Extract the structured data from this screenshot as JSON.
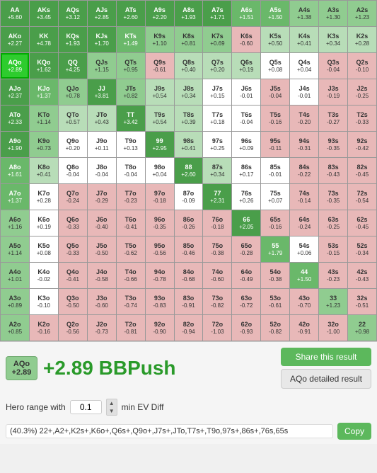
{
  "grid": {
    "cells": [
      {
        "name": "AA",
        "ev": "+5.60",
        "color": "green-dark"
      },
      {
        "name": "AKs",
        "ev": "+3.45",
        "color": "green-dark"
      },
      {
        "name": "AQs",
        "ev": "+3.12",
        "color": "green-dark"
      },
      {
        "name": "AJs",
        "ev": "+2.85",
        "color": "green-dark"
      },
      {
        "name": "ATs",
        "ev": "+2.60",
        "color": "green-dark"
      },
      {
        "name": "A9s",
        "ev": "+2.20",
        "color": "green-dark"
      },
      {
        "name": "A8s",
        "ev": "+1.93",
        "color": "green-dark"
      },
      {
        "name": "A7s",
        "ev": "+1.71",
        "color": "green-dark"
      },
      {
        "name": "A6s",
        "ev": "+1.51",
        "color": "green-mid"
      },
      {
        "name": "A5s",
        "ev": "+1.50",
        "color": "green-mid"
      },
      {
        "name": "A4s",
        "ev": "+1.38",
        "color": "green-light"
      },
      {
        "name": "A3s",
        "ev": "+1.30",
        "color": "green-light"
      },
      {
        "name": "A2s",
        "ev": "+1.23",
        "color": "green-light"
      },
      {
        "name": "AKo",
        "ev": "+2.27",
        "color": "green-dark"
      },
      {
        "name": "KK",
        "ev": "+4.78",
        "color": "green-dark"
      },
      {
        "name": "KQs",
        "ev": "+1.93",
        "color": "green-dark"
      },
      {
        "name": "KJs",
        "ev": "+1.70",
        "color": "green-dark"
      },
      {
        "name": "KTs",
        "ev": "+1.49",
        "color": "green-mid"
      },
      {
        "name": "K9s",
        "ev": "+1.10",
        "color": "green-light"
      },
      {
        "name": "K8s",
        "ev": "+0.81",
        "color": "green-light"
      },
      {
        "name": "K7s",
        "ev": "+0.69",
        "color": "green-light"
      },
      {
        "name": "K6s",
        "ev": "-0.60",
        "color": "red-pale"
      },
      {
        "name": "K5s",
        "ev": "+0.50",
        "color": "green-pale"
      },
      {
        "name": "K4s",
        "ev": "+0.41",
        "color": "green-pale"
      },
      {
        "name": "K3s",
        "ev": "+0.34",
        "color": "green-pale"
      },
      {
        "name": "K2s",
        "ev": "+0.28",
        "color": "green-pale"
      },
      {
        "name": "AQo",
        "ev": "+2.89",
        "color": "highlight"
      },
      {
        "name": "KQo",
        "ev": "+1.62",
        "color": "green-dark"
      },
      {
        "name": "QQ",
        "ev": "+4.25",
        "color": "green-dark"
      },
      {
        "name": "QJs",
        "ev": "+1.15",
        "color": "green-light"
      },
      {
        "name": "QTs",
        "ev": "+0.95",
        "color": "green-light"
      },
      {
        "name": "Q9s",
        "ev": "-0.61",
        "color": "red-pale"
      },
      {
        "name": "Q8s",
        "ev": "+0.40",
        "color": "green-pale"
      },
      {
        "name": "Q7s",
        "ev": "+0.20",
        "color": "green-pale"
      },
      {
        "name": "Q6s",
        "ev": "+0.19",
        "color": "green-pale"
      },
      {
        "name": "Q5s",
        "ev": "+0.08",
        "color": "white"
      },
      {
        "name": "Q4s",
        "ev": "+0.04",
        "color": "white"
      },
      {
        "name": "Q3s",
        "ev": "-0.04",
        "color": "red-pale"
      },
      {
        "name": "Q2s",
        "ev": "-0.10",
        "color": "red-pale"
      },
      {
        "name": "AJo",
        "ev": "+2.37",
        "color": "green-dark"
      },
      {
        "name": "KJo",
        "ev": "+1.37",
        "color": "green-mid"
      },
      {
        "name": "QJo",
        "ev": "+0.78",
        "color": "green-light"
      },
      {
        "name": "JJ",
        "ev": "+3.81",
        "color": "green-dark"
      },
      {
        "name": "JTs",
        "ev": "+0.82",
        "color": "green-light"
      },
      {
        "name": "J9s",
        "ev": "+0.54",
        "color": "green-pale"
      },
      {
        "name": "J8s",
        "ev": "+0.34",
        "color": "green-pale"
      },
      {
        "name": "J7s",
        "ev": "+0.15",
        "color": "white"
      },
      {
        "name": "J6s",
        "ev": "-0.01",
        "color": "white"
      },
      {
        "name": "J5s",
        "ev": "-0.04",
        "color": "red-pale"
      },
      {
        "name": "J4s",
        "ev": "-0.01",
        "color": "white"
      },
      {
        "name": "J3s",
        "ev": "-0.19",
        "color": "red-pale"
      },
      {
        "name": "J2s",
        "ev": "-0.25",
        "color": "red-pale"
      },
      {
        "name": "ATo",
        "ev": "+2.33",
        "color": "green-dark"
      },
      {
        "name": "KTo",
        "ev": "+1.14",
        "color": "green-light"
      },
      {
        "name": "QTo",
        "ev": "+0.57",
        "color": "green-pale"
      },
      {
        "name": "JTo",
        "ev": "+0.43",
        "color": "green-pale"
      },
      {
        "name": "TT",
        "ev": "+3.42",
        "color": "green-dark"
      },
      {
        "name": "T9s",
        "ev": "+0.54",
        "color": "green-pale"
      },
      {
        "name": "T8s",
        "ev": "+0.39",
        "color": "green-pale"
      },
      {
        "name": "T7s",
        "ev": "+0.18",
        "color": "white"
      },
      {
        "name": "T6s",
        "ev": "-0.04",
        "color": "white"
      },
      {
        "name": "T5s",
        "ev": "-0.16",
        "color": "red-pale"
      },
      {
        "name": "T4s",
        "ev": "-0.20",
        "color": "red-pale"
      },
      {
        "name": "T3s",
        "ev": "-0.27",
        "color": "red-pale"
      },
      {
        "name": "T2s",
        "ev": "-0.33",
        "color": "red-pale"
      },
      {
        "name": "A9o",
        "ev": "+1.90",
        "color": "green-dark"
      },
      {
        "name": "K9o",
        "ev": "+0.73",
        "color": "green-light"
      },
      {
        "name": "Q9o",
        "ev": "+0.20",
        "color": "white"
      },
      {
        "name": "J9o",
        "ev": "+0.11",
        "color": "white"
      },
      {
        "name": "T9o",
        "ev": "+0.13",
        "color": "white"
      },
      {
        "name": "99",
        "ev": "+2.95",
        "color": "green-dark"
      },
      {
        "name": "98s",
        "ev": "+0.41",
        "color": "green-pale"
      },
      {
        "name": "97s",
        "ev": "+0.25",
        "color": "white"
      },
      {
        "name": "96s",
        "ev": "+0.09",
        "color": "white"
      },
      {
        "name": "95s",
        "ev": "-0.11",
        "color": "red-pale"
      },
      {
        "name": "94s",
        "ev": "-0.31",
        "color": "red-pale"
      },
      {
        "name": "93s",
        "ev": "-0.35",
        "color": "red-pale"
      },
      {
        "name": "92s",
        "ev": "-0.42",
        "color": "red-pale"
      },
      {
        "name": "A8o",
        "ev": "+1.61",
        "color": "green-mid"
      },
      {
        "name": "K8o",
        "ev": "+0.41",
        "color": "green-pale"
      },
      {
        "name": "Q8o",
        "ev": "-0.04",
        "color": "white"
      },
      {
        "name": "J8o",
        "ev": "-0.04",
        "color": "white"
      },
      {
        "name": "T8o",
        "ev": "-0.04",
        "color": "white"
      },
      {
        "name": "98o",
        "ev": "+0.04",
        "color": "white"
      },
      {
        "name": "88",
        "ev": "+2.60",
        "color": "green-dark"
      },
      {
        "name": "87s",
        "ev": "+0.34",
        "color": "green-pale"
      },
      {
        "name": "86s",
        "ev": "+0.17",
        "color": "white"
      },
      {
        "name": "85s",
        "ev": "-0.01",
        "color": "white"
      },
      {
        "name": "84s",
        "ev": "-0.22",
        "color": "red-pale"
      },
      {
        "name": "83s",
        "ev": "-0.43",
        "color": "red-pale"
      },
      {
        "name": "82s",
        "ev": "-0.45",
        "color": "red-pale"
      },
      {
        "name": "A7o",
        "ev": "+1.37",
        "color": "green-mid"
      },
      {
        "name": "K7o",
        "ev": "+0.28",
        "color": "white"
      },
      {
        "name": "Q7o",
        "ev": "-0.24",
        "color": "red-pale"
      },
      {
        "name": "J7o",
        "ev": "-0.29",
        "color": "red-pale"
      },
      {
        "name": "T7o",
        "ev": "-0.23",
        "color": "red-pale"
      },
      {
        "name": "97o",
        "ev": "-0.18",
        "color": "red-pale"
      },
      {
        "name": "87o",
        "ev": "-0.09",
        "color": "white"
      },
      {
        "name": "77",
        "ev": "+2.31",
        "color": "green-dark"
      },
      {
        "name": "76s",
        "ev": "+0.26",
        "color": "white"
      },
      {
        "name": "75s",
        "ev": "+0.07",
        "color": "white"
      },
      {
        "name": "74s",
        "ev": "-0.14",
        "color": "red-pale"
      },
      {
        "name": "73s",
        "ev": "-0.35",
        "color": "red-pale"
      },
      {
        "name": "72s",
        "ev": "-0.54",
        "color": "red-pale"
      },
      {
        "name": "A6o",
        "ev": "+1.16",
        "color": "green-light"
      },
      {
        "name": "K6o",
        "ev": "+0.19",
        "color": "white"
      },
      {
        "name": "Q6o",
        "ev": "-0.33",
        "color": "red-pale"
      },
      {
        "name": "J6o",
        "ev": "-0.40",
        "color": "red-pale"
      },
      {
        "name": "T6o",
        "ev": "-0.41",
        "color": "red-pale"
      },
      {
        "name": "96o",
        "ev": "-0.35",
        "color": "red-pale"
      },
      {
        "name": "86o",
        "ev": "-0.26",
        "color": "red-pale"
      },
      {
        "name": "76o",
        "ev": "-0.18",
        "color": "red-pale"
      },
      {
        "name": "66",
        "ev": "+2.05",
        "color": "green-dark"
      },
      {
        "name": "65s",
        "ev": "-0.16",
        "color": "red-pale"
      },
      {
        "name": "64s",
        "ev": "-0.24",
        "color": "red-pale"
      },
      {
        "name": "63s",
        "ev": "-0.25",
        "color": "red-pale"
      },
      {
        "name": "62s",
        "ev": "-0.45",
        "color": "red-pale"
      },
      {
        "name": "A5o",
        "ev": "+1.14",
        "color": "green-light"
      },
      {
        "name": "K5o",
        "ev": "+0.08",
        "color": "white"
      },
      {
        "name": "Q5o",
        "ev": "-0.33",
        "color": "red-pale"
      },
      {
        "name": "J5o",
        "ev": "-0.50",
        "color": "red-pale"
      },
      {
        "name": "T5o",
        "ev": "-0.62",
        "color": "red-pale"
      },
      {
        "name": "95o",
        "ev": "-0.56",
        "color": "red-pale"
      },
      {
        "name": "85o",
        "ev": "-0.46",
        "color": "red-pale"
      },
      {
        "name": "75o",
        "ev": "-0.38",
        "color": "red-pale"
      },
      {
        "name": "65o",
        "ev": "-0.28",
        "color": "red-pale"
      },
      {
        "name": "55",
        "ev": "+1.79",
        "color": "green-mid"
      },
      {
        "name": "54s",
        "ev": "+0.06",
        "color": "white"
      },
      {
        "name": "53s",
        "ev": "-0.15",
        "color": "red-pale"
      },
      {
        "name": "52s",
        "ev": "-0.34",
        "color": "red-pale"
      },
      {
        "name": "A4o",
        "ev": "+1.01",
        "color": "green-light"
      },
      {
        "name": "K4o",
        "ev": "-0.02",
        "color": "white"
      },
      {
        "name": "Q4o",
        "ev": "-0.41",
        "color": "red-pale"
      },
      {
        "name": "J4o",
        "ev": "-0.58",
        "color": "red-pale"
      },
      {
        "name": "T4o",
        "ev": "-0.66",
        "color": "red-pale"
      },
      {
        "name": "94o",
        "ev": "-0.78",
        "color": "red-pale"
      },
      {
        "name": "84o",
        "ev": "-0.68",
        "color": "red-pale"
      },
      {
        "name": "74o",
        "ev": "-0.60",
        "color": "red-pale"
      },
      {
        "name": "64o",
        "ev": "-0.49",
        "color": "red-pale"
      },
      {
        "name": "54o",
        "ev": "-0.38",
        "color": "red-pale"
      },
      {
        "name": "44",
        "ev": "+1.50",
        "color": "green-mid"
      },
      {
        "name": "43s",
        "ev": "-0.23",
        "color": "red-pale"
      },
      {
        "name": "42s",
        "ev": "-0.43",
        "color": "red-pale"
      },
      {
        "name": "A3o",
        "ev": "+0.89",
        "color": "green-light"
      },
      {
        "name": "K3o",
        "ev": "-0.10",
        "color": "white"
      },
      {
        "name": "Q3o",
        "ev": "-0.50",
        "color": "red-pale"
      },
      {
        "name": "J3o",
        "ev": "-0.60",
        "color": "red-pale"
      },
      {
        "name": "T3o",
        "ev": "-0.74",
        "color": "red-pale"
      },
      {
        "name": "93o",
        "ev": "-0.83",
        "color": "red-pale"
      },
      {
        "name": "83o",
        "ev": "-0.91",
        "color": "red-pale"
      },
      {
        "name": "73o",
        "ev": "-0.82",
        "color": "red-pale"
      },
      {
        "name": "63o",
        "ev": "-0.72",
        "color": "red-pale"
      },
      {
        "name": "53o",
        "ev": "-0.61",
        "color": "red-pale"
      },
      {
        "name": "43o",
        "ev": "-0.70",
        "color": "red-pale"
      },
      {
        "name": "33",
        "ev": "+1.23",
        "color": "green-light"
      },
      {
        "name": "32s",
        "ev": "-0.51",
        "color": "red-pale"
      },
      {
        "name": "A2o",
        "ev": "+0.85",
        "color": "green-light"
      },
      {
        "name": "K2o",
        "ev": "-0.16",
        "color": "red-pale"
      },
      {
        "name": "Q2o",
        "ev": "-0.56",
        "color": "red-pale"
      },
      {
        "name": "J2o",
        "ev": "-0.73",
        "color": "red-pale"
      },
      {
        "name": "T2o",
        "ev": "-0.81",
        "color": "red-pale"
      },
      {
        "name": "92o",
        "ev": "-0.90",
        "color": "red-pale"
      },
      {
        "name": "82o",
        "ev": "-0.94",
        "color": "red-pale"
      },
      {
        "name": "72o",
        "ev": "-1.03",
        "color": "red-pale"
      },
      {
        "name": "62o",
        "ev": "-0.93",
        "color": "red-pale"
      },
      {
        "name": "52o",
        "ev": "-0.82",
        "color": "red-pale"
      },
      {
        "name": "42o",
        "ev": "-0.91",
        "color": "red-pale"
      },
      {
        "name": "32o",
        "ev": "-1.00",
        "color": "red-pale"
      },
      {
        "name": "22",
        "ev": "+0.98",
        "color": "green-light"
      }
    ]
  },
  "result": {
    "badge_hand": "AQo",
    "badge_ev": "+2.89",
    "value_text": "+2.89 BBPush",
    "share_button": "Share this result",
    "detail_button": "AQo detailed result"
  },
  "hero_range": {
    "label": "Hero range with",
    "input_value": "0.1",
    "suffix": "min EV Diff"
  },
  "range_output": {
    "text": "(40.3%) 22+,A2+,K2s+,K6o+,Q6s+,Q9o+,J7s+,JTo,T7s+,T9o,97s+,86s+,76s,65s",
    "copy_button": "Copy"
  }
}
